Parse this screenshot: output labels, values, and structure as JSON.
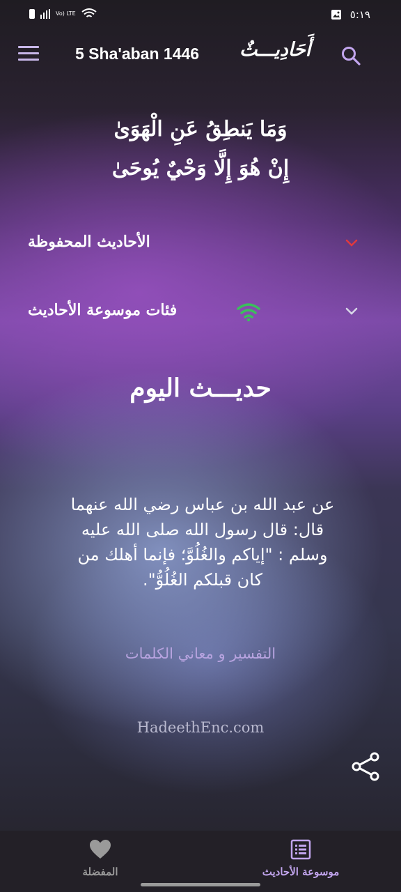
{
  "status_bar": {
    "network": "Vo) LTE",
    "time": "٥:١٩"
  },
  "app_bar": {
    "date": "5 Sha'aban 1446",
    "logo": "أَحَادِيـــثٌ"
  },
  "verse": {
    "line1": "وَمَا يَنطِقُ عَنِ الْهَوَىٰ",
    "line2": "إِنْ هُوَ إِلَّا وَحْيٌ يُوحَىٰ"
  },
  "sections": {
    "saved_label": "الأحاديث المحفوظة",
    "categories_label": "فئات موسوعة الأحاديث"
  },
  "today": {
    "title": "حديـــث اليوم",
    "text": "عن عبد الله بن عباس رضي الله عنهما قال: قال رسول الله صلى الله عليه وسلم : \"إياكم والغُلُوَّ؛ فإنما أهلك من كان قبلكم الغُلُوُّ\".",
    "explanation_link": "التفسير و معاني الكلمات",
    "source": "HadeethEnc.com"
  },
  "bottom_nav": {
    "favorites_label": "المفضلة",
    "encyclopedia_label": "موسوعة الأحاديث"
  },
  "colors": {
    "accent": "#c2a5ee",
    "chevron_red": "#e0393e",
    "wifi_green": "#3bbf5c"
  },
  "icons": {
    "menu": "hamburger-icon",
    "search": "search-icon",
    "share": "share-icon",
    "favorites": "heart-icon",
    "encyclopedia": "list-document-icon"
  }
}
